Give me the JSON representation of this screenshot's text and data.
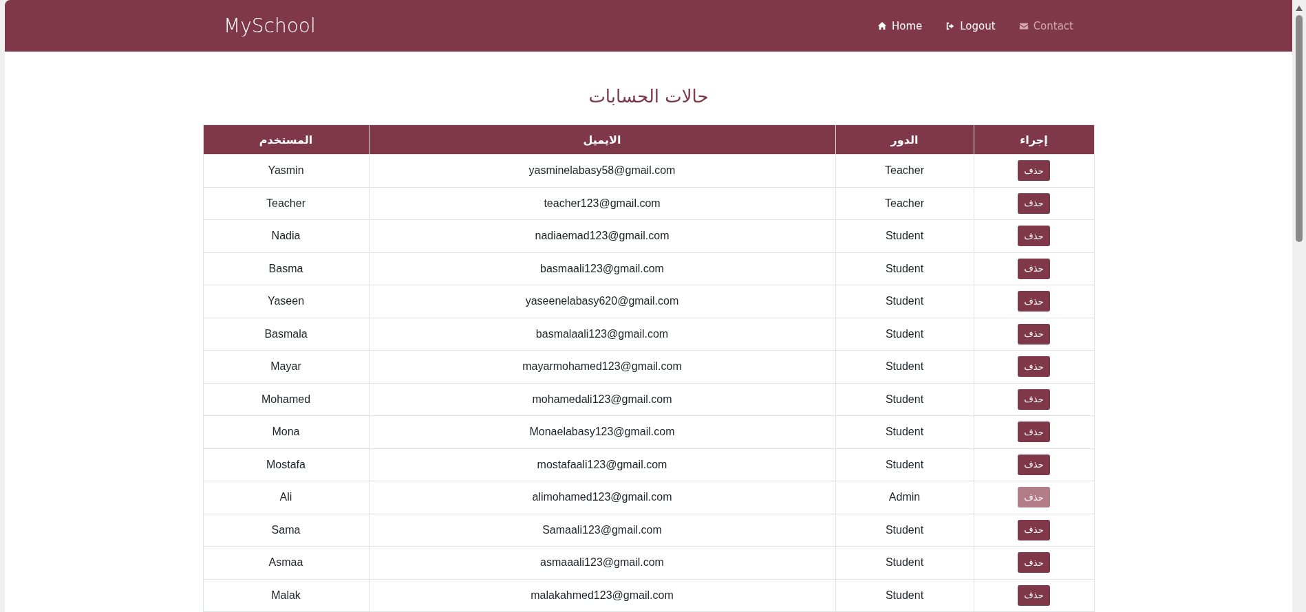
{
  "navbar": {
    "brand": "MySchool",
    "links": [
      {
        "label": "Home",
        "kind": "home",
        "disabled": false
      },
      {
        "label": "Logout",
        "kind": "logout",
        "disabled": false
      },
      {
        "label": "Contact",
        "kind": "mail",
        "disabled": true
      }
    ]
  },
  "page_title": "حالات الحسابات",
  "table": {
    "columns": [
      "إجراء",
      "الدور",
      "الايميل",
      "المستخدم"
    ],
    "rows": [
      {
        "user": "Yasmin",
        "email": "yasminelabasy58@gmail.com",
        "role": "Teacher",
        "action": "حذف",
        "disabled": false
      },
      {
        "user": "Teacher",
        "email": "teacher123@gmail.com",
        "role": "Teacher",
        "action": "حذف",
        "disabled": false
      },
      {
        "user": "Nadia",
        "email": "nadiaemad123@gmail.com",
        "role": "Student",
        "action": "حذف",
        "disabled": false
      },
      {
        "user": "Basma",
        "email": "basmaali123@gmail.com",
        "role": "Student",
        "action": "حذف",
        "disabled": false
      },
      {
        "user": "Yaseen",
        "email": "yaseenelabasy620@gmail.com",
        "role": "Student",
        "action": "حذف",
        "disabled": false
      },
      {
        "user": "Basmala",
        "email": "basmalaali123@gmail.com",
        "role": "Student",
        "action": "حذف",
        "disabled": false
      },
      {
        "user": "Mayar",
        "email": "mayarmohamed123@gmail.com",
        "role": "Student",
        "action": "حذف",
        "disabled": false
      },
      {
        "user": "Mohamed",
        "email": "mohamedali123@gmail.com",
        "role": "Student",
        "action": "حذف",
        "disabled": false
      },
      {
        "user": "Mona",
        "email": "Monaelabasy123@gmail.com",
        "role": "Student",
        "action": "حذف",
        "disabled": false
      },
      {
        "user": "Mostafa",
        "email": "mostafaali123@gmail.com",
        "role": "Student",
        "action": "حذف",
        "disabled": false
      },
      {
        "user": "Ali",
        "email": "alimohamed123@gmail.com",
        "role": "Admin",
        "action": "حذف",
        "disabled": true
      },
      {
        "user": "Sama",
        "email": "Samaali123@gmail.com",
        "role": "Student",
        "action": "حذف",
        "disabled": false
      },
      {
        "user": "Asmaa",
        "email": "asmaaali123@gmail.com",
        "role": "Student",
        "action": "حذف",
        "disabled": false
      },
      {
        "user": "Malak",
        "email": "malakahmed123@gmail.com",
        "role": "Student",
        "action": "حذف",
        "disabled": false
      }
    ]
  }
}
